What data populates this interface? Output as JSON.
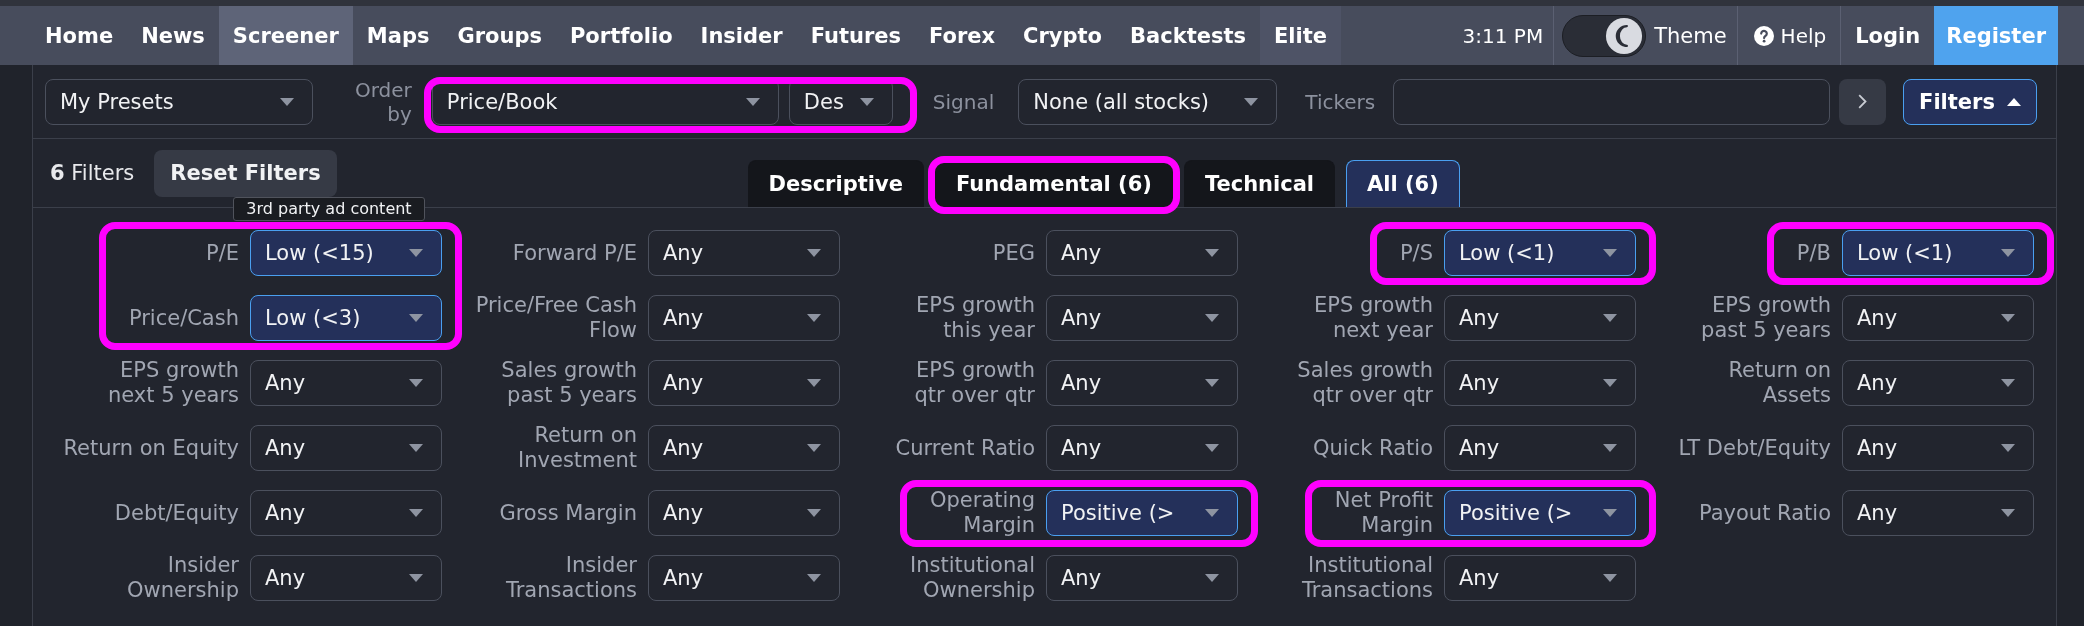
{
  "nav": {
    "items": [
      {
        "label": "Home",
        "selected": false,
        "kind": "link"
      },
      {
        "label": "News",
        "selected": false,
        "kind": "link"
      },
      {
        "label": "Screener",
        "selected": true,
        "kind": "link"
      },
      {
        "label": "Maps",
        "selected": false,
        "kind": "link"
      },
      {
        "label": "Groups",
        "selected": false,
        "kind": "link"
      },
      {
        "label": "Portfolio",
        "selected": false,
        "kind": "link"
      },
      {
        "label": "Insider",
        "selected": false,
        "kind": "link"
      },
      {
        "label": "Futures",
        "selected": false,
        "kind": "link"
      },
      {
        "label": "Forex",
        "selected": false,
        "kind": "link"
      },
      {
        "label": "Crypto",
        "selected": false,
        "kind": "link"
      },
      {
        "label": "Backtests",
        "selected": false,
        "kind": "link"
      },
      {
        "label": "Elite",
        "selected": false,
        "kind": "premium"
      }
    ],
    "time": "3:11 PM",
    "theme": {
      "label": "Theme",
      "on": true
    },
    "help": "Help",
    "login": "Login",
    "register": "Register"
  },
  "toolbar": {
    "presets": "My Presets",
    "order_by": {
      "label": "Order\nby",
      "field": "Price/Book",
      "direction": "Des",
      "highlighted": true
    },
    "signal": {
      "label": "Signal",
      "value": "None (all stocks)"
    },
    "tickers": {
      "label": "Tickers"
    },
    "filters_button": {
      "label": "Filters",
      "expanded": true
    }
  },
  "filter_bar": {
    "count": "**6** Filters",
    "reset": "Reset Filters",
    "tooltip": "3rd party ad content",
    "tabs": [
      {
        "label": "Descriptive",
        "selected": false,
        "highlighted": false
      },
      {
        "label": "Fundamental (6)",
        "selected": false,
        "highlighted": true
      },
      {
        "label": "Technical",
        "selected": false,
        "highlighted": false
      },
      {
        "label": "All (6)",
        "selected": true,
        "highlighted": false
      }
    ]
  },
  "filters": [
    {
      "label": "P/E",
      "value": "Low (<15)",
      "active": true,
      "highlighted": true
    },
    {
      "label": "Forward P/E",
      "value": "Any",
      "active": false,
      "highlighted": false
    },
    {
      "label": "PEG",
      "value": "Any",
      "active": false,
      "highlighted": false
    },
    {
      "label": "P/S",
      "value": "Low (<1)",
      "active": true,
      "highlighted": true
    },
    {
      "label": "P/B",
      "value": "Low (<1)",
      "active": true,
      "highlighted": true
    },
    {
      "label": "Price/Cash",
      "value": "Low (<3)",
      "active": true,
      "highlighted": true
    },
    {
      "label": "Price/Free Cash\nFlow",
      "value": "Any",
      "active": false,
      "highlighted": false
    },
    {
      "label": "EPS growth\nthis year",
      "value": "Any",
      "active": false,
      "highlighted": false
    },
    {
      "label": "EPS growth\nnext year",
      "value": "Any",
      "active": false,
      "highlighted": false
    },
    {
      "label": "EPS growth\npast 5 years",
      "value": "Any",
      "active": false,
      "highlighted": false
    },
    {
      "label": "EPS growth\nnext 5 years",
      "value": "Any",
      "active": false,
      "highlighted": false
    },
    {
      "label": "Sales growth\npast 5 years",
      "value": "Any",
      "active": false,
      "highlighted": false
    },
    {
      "label": "EPS growth\nqtr over qtr",
      "value": "Any",
      "active": false,
      "highlighted": false
    },
    {
      "label": "Sales growth\nqtr over qtr",
      "value": "Any",
      "active": false,
      "highlighted": false
    },
    {
      "label": "Return on\nAssets",
      "value": "Any",
      "active": false,
      "highlighted": false
    },
    {
      "label": "Return on Equity",
      "value": "Any",
      "active": false,
      "highlighted": false
    },
    {
      "label": "Return on\nInvestment",
      "value": "Any",
      "active": false,
      "highlighted": false
    },
    {
      "label": "Current Ratio",
      "value": "Any",
      "active": false,
      "highlighted": false
    },
    {
      "label": "Quick Ratio",
      "value": "Any",
      "active": false,
      "highlighted": false
    },
    {
      "label": "LT Debt/Equity",
      "value": "Any",
      "active": false,
      "highlighted": false
    },
    {
      "label": "Debt/Equity",
      "value": "Any",
      "active": false,
      "highlighted": false
    },
    {
      "label": "Gross Margin",
      "value": "Any",
      "active": false,
      "highlighted": false
    },
    {
      "label": "Operating\nMargin",
      "value": "Positive (>",
      "active": true,
      "highlighted": true
    },
    {
      "label": "Net Profit\nMargin",
      "value": "Positive (>",
      "active": true,
      "highlighted": true
    },
    {
      "label": "Payout Ratio",
      "value": "Any",
      "active": false,
      "highlighted": false
    },
    {
      "label": "Insider\nOwnership",
      "value": "Any",
      "active": false,
      "highlighted": false
    },
    {
      "label": "Insider\nTransactions",
      "value": "Any",
      "active": false,
      "highlighted": false
    },
    {
      "label": "Institutional\nOwnership",
      "value": "Any",
      "active": false,
      "highlighted": false
    },
    {
      "label": "Institutional\nTransactions",
      "value": "Any",
      "active": false,
      "highlighted": false
    }
  ]
}
